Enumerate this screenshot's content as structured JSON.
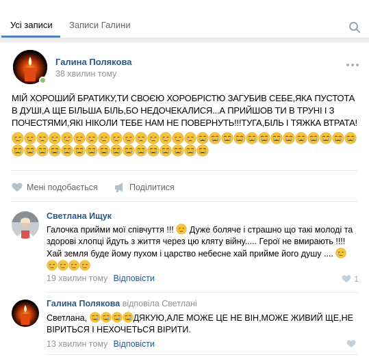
{
  "tabs": [
    {
      "label": "Усі записи",
      "active": true
    },
    {
      "label": "Записи Галини",
      "active": false
    }
  ],
  "colors": {
    "link": "#2a5885",
    "accent": "#5181b8",
    "muted": "#939393",
    "online": "#8ac176"
  },
  "post": {
    "author": "Галина Полякова",
    "time": "38 хвилин тому",
    "text": "МІЙ ХОРОШИЙ БРАТИКУ,ТИ СВОЄЮ ХОРОБРІСТЮ ЗАГУБИВ СЕБЕ,ЯКА ПУСТОТА В ДУШІ,А ЩЕ БІЛЬША БІЛЬ,БО НЕДОЧЕКАЛИСЯ...А ПРИЙШОВ ТИ В ТРУНІ І З ПОЧЕСТЯМИ,ЯКІ НІКОЛИ ТЕБЕ НАМ НЕ ПОВЕРНУТЬ!!!ТУГА,БІЛЬ І ТЯЖКА ВТРАТА!",
    "emoji_line1": {
      "sad_count": 15,
      "crying_count": 13
    },
    "emoji_line2": {
      "crying_count": 16
    },
    "like_label": "Мені подобається",
    "share_label": "Поділитися"
  },
  "comments": [
    {
      "author": "Светлана Ищук",
      "text_part1": "Галочка прийми мої співчуття !!! ",
      "text_part2": " Дуже боляче і страшно що такі молоді та здорові хлопці йдуть з життя через цю кляту війну..... Герої не вмирають !!!! Хай земля буде йому пухом і царство небесне хай прийме його душу .... ",
      "time": "19 хвилин тому",
      "reply_label": "Відповісти",
      "likes": "1"
    },
    {
      "author": "Галина Полякова",
      "replied_to": "відповіла Светлані",
      "text_prefix": "Светлана, ",
      "text_suffix": "ДЯКУЮ,АЛЕ МОЖЕ ЦЕ НЕ ВІН,МОЖЕ ЖИВИЙ ЩЕ,НЕ ВІРИТЬСЯ І НЕХОЧЕТЬСЯ ВІРИТИ.",
      "time": "13 хвилин тому",
      "reply_label": "Відповісти"
    }
  ]
}
